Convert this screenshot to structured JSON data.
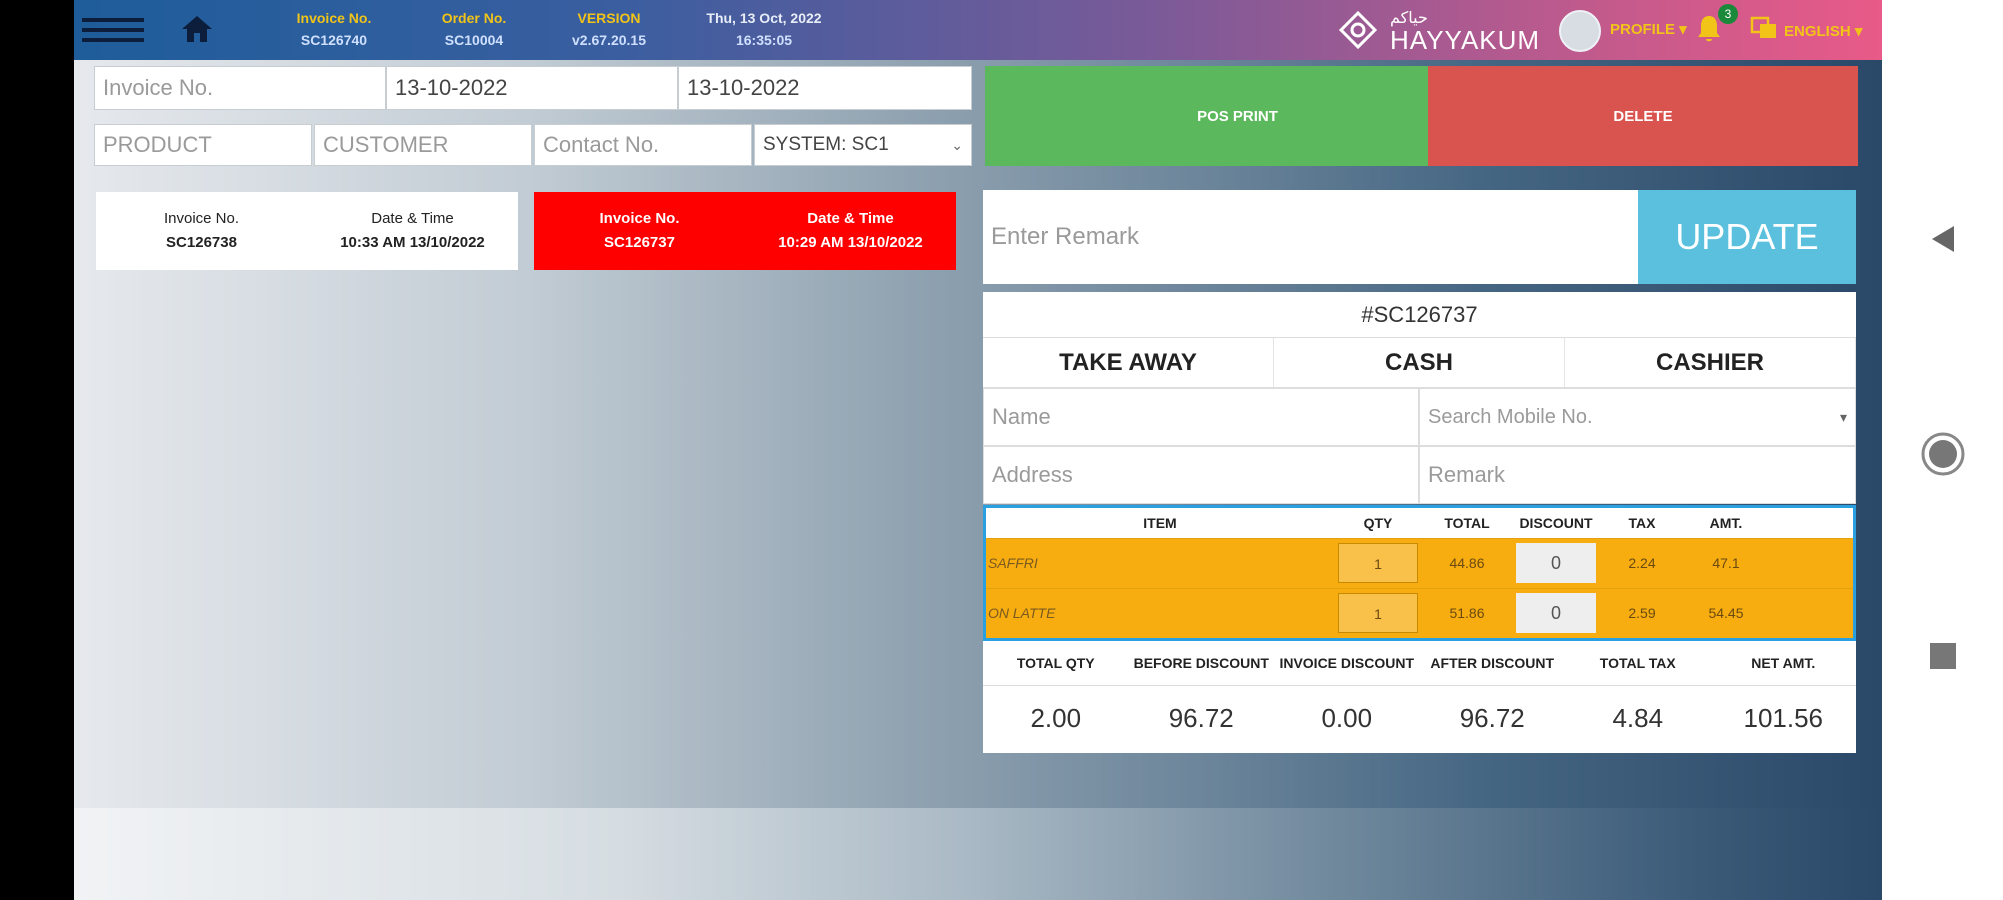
{
  "header": {
    "invoice_no_label": "Invoice No.",
    "invoice_no_value": "SC126740",
    "order_no_label": "Order No.",
    "order_no_value": "SC10004",
    "version_label": "VERSION",
    "version_value": "v2.67.20.15",
    "date_label": "Thu, 13 Oct, 2022",
    "time_value": "16:35:05",
    "brand_name": "HAYYAKUM",
    "brand_arabic": "حياكم",
    "profile_label": "PROFILE",
    "notification_count": "3",
    "language_label": "ENGLISH",
    "icons": [
      "menu-icon",
      "home-icon",
      "bell-icon",
      "language-icon"
    ]
  },
  "filters": {
    "invoice_placeholder": "Invoice No.",
    "date_from": "13-10-2022",
    "date_to": "13-10-2022",
    "product_placeholder": "PRODUCT",
    "customer_placeholder": "CUSTOMER",
    "contact_placeholder": "Contact No.",
    "system_value": "SYSTEM: SC1"
  },
  "actions": {
    "pos_print": "POS PRINT",
    "delete": "DELETE",
    "remark_placeholder": "Enter Remark",
    "update": "UPDATE"
  },
  "invoice_cards": [
    {
      "inv_label": "Invoice No.",
      "inv_value": "SC126738",
      "dt_label": "Date & Time",
      "dt_value": "10:33 AM 13/10/2022",
      "selected": false
    },
    {
      "inv_label": "Invoice No.",
      "inv_value": "SC126737",
      "dt_label": "Date & Time",
      "dt_value": "10:29 AM 13/10/2022",
      "selected": true
    }
  ],
  "detail": {
    "invoice_id": "#SC126737",
    "order_type": "TAKE AWAY",
    "payment": "CASH",
    "user": "CASHIER",
    "name_placeholder": "Name",
    "mobile_placeholder": "Search Mobile No.",
    "address_placeholder": "Address",
    "remark_placeholder": "Remark"
  },
  "items_table": {
    "columns": [
      "ITEM",
      "QTY",
      "TOTAL",
      "DISCOUNT",
      "TAX",
      "AMT."
    ],
    "rows": [
      {
        "item": "SAFFRI",
        "qty": "1",
        "total": "44.86",
        "discount": "0",
        "tax": "2.24",
        "amt": "47.1"
      },
      {
        "item": "ON LATTE",
        "qty": "1",
        "total": "51.86",
        "discount": "0",
        "tax": "2.59",
        "amt": "54.45"
      }
    ]
  },
  "totals": {
    "columns": [
      "TOTAL QTY",
      "BEFORE DISCOUNT",
      "INVOICE DISCOUNT",
      "AFTER DISCOUNT",
      "TOTAL TAX",
      "NET AMT."
    ],
    "values": [
      "2.00",
      "96.72",
      "0.00",
      "96.72",
      "4.84",
      "101.56"
    ]
  },
  "colors": {
    "pos_print": "#5cb85c",
    "delete": "#d9534f",
    "update": "#5bc0de",
    "selected_card": "#ff0000",
    "item_row": "#f7ad10",
    "accent_yellow": "#f2c418"
  }
}
